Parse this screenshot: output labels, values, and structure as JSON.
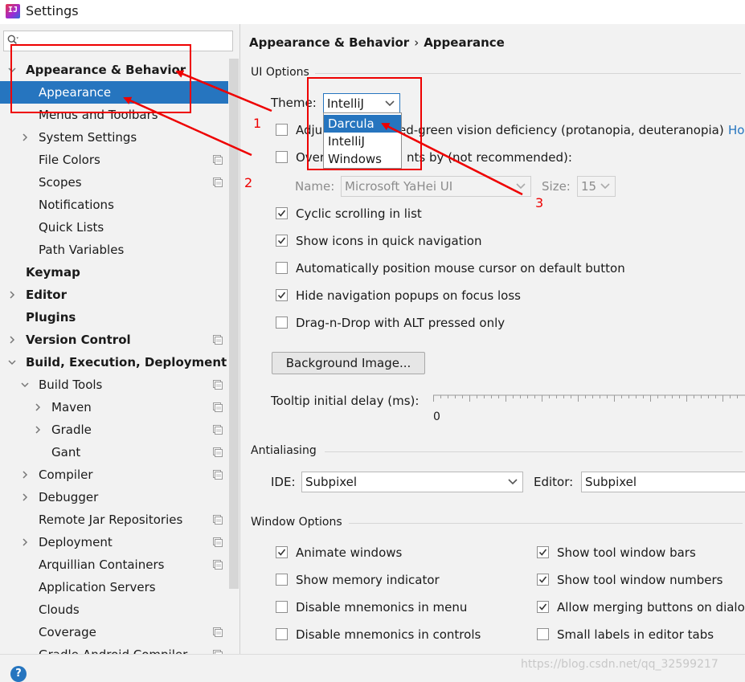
{
  "window": {
    "title": "Settings"
  },
  "search": {
    "placeholder": ""
  },
  "sidebar": {
    "items": [
      {
        "label": "Appearance & Behavior",
        "level": 0,
        "bold": true,
        "arrow": "down",
        "selected": false,
        "project": false
      },
      {
        "label": "Appearance",
        "level": 1,
        "bold": false,
        "arrow": "",
        "selected": true,
        "project": false
      },
      {
        "label": "Menus and Toolbars",
        "level": 1,
        "bold": false,
        "arrow": "",
        "selected": false,
        "project": false
      },
      {
        "label": "System Settings",
        "level": 1,
        "bold": false,
        "arrow": "right",
        "selected": false,
        "project": false
      },
      {
        "label": "File Colors",
        "level": 1,
        "bold": false,
        "arrow": "",
        "selected": false,
        "project": true
      },
      {
        "label": "Scopes",
        "level": 1,
        "bold": false,
        "arrow": "",
        "selected": false,
        "project": true
      },
      {
        "label": "Notifications",
        "level": 1,
        "bold": false,
        "arrow": "",
        "selected": false,
        "project": false
      },
      {
        "label": "Quick Lists",
        "level": 1,
        "bold": false,
        "arrow": "",
        "selected": false,
        "project": false
      },
      {
        "label": "Path Variables",
        "level": 1,
        "bold": false,
        "arrow": "",
        "selected": false,
        "project": false
      },
      {
        "label": "Keymap",
        "level": 0,
        "bold": true,
        "arrow": "",
        "selected": false,
        "project": false
      },
      {
        "label": "Editor",
        "level": 0,
        "bold": true,
        "arrow": "right",
        "selected": false,
        "project": false
      },
      {
        "label": "Plugins",
        "level": 0,
        "bold": true,
        "arrow": "",
        "selected": false,
        "project": false
      },
      {
        "label": "Version Control",
        "level": 0,
        "bold": true,
        "arrow": "right",
        "selected": false,
        "project": true
      },
      {
        "label": "Build, Execution, Deployment",
        "level": 0,
        "bold": true,
        "arrow": "down",
        "selected": false,
        "project": false
      },
      {
        "label": "Build Tools",
        "level": 1,
        "bold": false,
        "arrow": "down",
        "selected": false,
        "project": true
      },
      {
        "label": "Maven",
        "level": 2,
        "bold": false,
        "arrow": "right",
        "selected": false,
        "project": true
      },
      {
        "label": "Gradle",
        "level": 2,
        "bold": false,
        "arrow": "right",
        "selected": false,
        "project": true
      },
      {
        "label": "Gant",
        "level": 2,
        "bold": false,
        "arrow": "",
        "selected": false,
        "project": true
      },
      {
        "label": "Compiler",
        "level": 1,
        "bold": false,
        "arrow": "right",
        "selected": false,
        "project": true
      },
      {
        "label": "Debugger",
        "level": 1,
        "bold": false,
        "arrow": "right",
        "selected": false,
        "project": false
      },
      {
        "label": "Remote Jar Repositories",
        "level": 1,
        "bold": false,
        "arrow": "",
        "selected": false,
        "project": true
      },
      {
        "label": "Deployment",
        "level": 1,
        "bold": false,
        "arrow": "right",
        "selected": false,
        "project": true
      },
      {
        "label": "Arquillian Containers",
        "level": 1,
        "bold": false,
        "arrow": "",
        "selected": false,
        "project": true
      },
      {
        "label": "Application Servers",
        "level": 1,
        "bold": false,
        "arrow": "",
        "selected": false,
        "project": false
      },
      {
        "label": "Clouds",
        "level": 1,
        "bold": false,
        "arrow": "",
        "selected": false,
        "project": false
      },
      {
        "label": "Coverage",
        "level": 1,
        "bold": false,
        "arrow": "",
        "selected": false,
        "project": true
      },
      {
        "label": "Gradle-Android Compiler",
        "level": 1,
        "bold": false,
        "arrow": "",
        "selected": false,
        "project": true
      }
    ]
  },
  "breadcrumb": {
    "parent": "Appearance & Behavior",
    "separator": "›",
    "current": "Appearance"
  },
  "ui_options": {
    "title": "UI Options",
    "theme_label": "Theme:",
    "theme_value": "IntelliJ",
    "theme_options": [
      "Darcula",
      "IntelliJ",
      "Windows"
    ],
    "theme_selected_option": "Darcula",
    "adjust_colors_left": "Adju",
    "adjust_colors_right": "ed-green vision deficiency (protanopia, deuteranopia)",
    "adjust_colors_link": "Ho",
    "override_fonts_left": "Over",
    "override_fonts_right": "nts by (not recommended):",
    "font_name_label": "Name:",
    "font_name_value": "Microsoft YaHei UI",
    "font_size_label": "Size:",
    "font_size_value": "15",
    "checkboxes": [
      {
        "label": "Cyclic scrolling in list",
        "checked": true
      },
      {
        "label": "Show icons in quick navigation",
        "checked": true
      },
      {
        "label": "Automatically position mouse cursor on default button",
        "checked": false
      },
      {
        "label": "Hide navigation popups on focus loss",
        "checked": true
      },
      {
        "label": "Drag-n-Drop with ALT pressed only",
        "checked": false
      }
    ],
    "background_image_button": "Background Image...",
    "tooltip_label": "Tooltip initial delay (ms):",
    "tooltip_value": "0"
  },
  "antialiasing": {
    "title": "Antialiasing",
    "ide_label": "IDE:",
    "ide_value": "Subpixel",
    "editor_label": "Editor:",
    "editor_value": "Subpixel"
  },
  "window_options": {
    "title": "Window Options",
    "left": [
      {
        "label": "Animate windows",
        "checked": true
      },
      {
        "label": "Show memory indicator",
        "checked": false
      },
      {
        "label": "Disable mnemonics in menu",
        "checked": false
      },
      {
        "label": "Disable mnemonics in controls",
        "checked": false
      }
    ],
    "right": [
      {
        "label": "Show tool window bars",
        "checked": true
      },
      {
        "label": "Show tool window numbers",
        "checked": true
      },
      {
        "label": "Allow merging buttons on dialogs",
        "checked": true
      },
      {
        "label": "Small labels in editor tabs",
        "checked": false
      }
    ]
  },
  "annotations": {
    "n1": "1",
    "n2": "2",
    "n3": "3",
    "color": "#e00000"
  },
  "watermark": "https://blog.csdn.net/qq_32599217",
  "help": "?",
  "colors": {
    "selection": "#2675bf",
    "link": "#2675bf"
  }
}
